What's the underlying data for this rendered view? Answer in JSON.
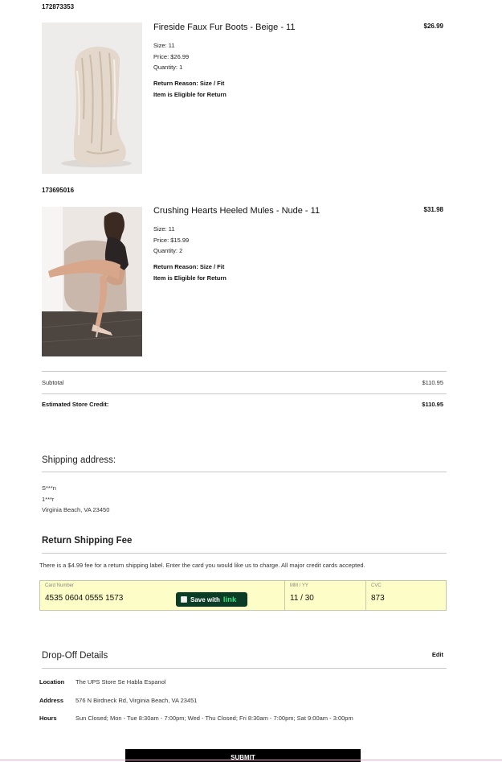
{
  "items": [
    {
      "order_id": "172873353",
      "title": "Fireside Faux Fur Boots - Beige - 11",
      "total": "$26.99",
      "size": "Size: 11",
      "price": "Price: $26.99",
      "quantity": "Quantity: 1",
      "return_reason": "Return Reason: Size / Fit",
      "eligibility": "Item is Eligible for Return"
    },
    {
      "order_id": "173695016",
      "title": "Crushing Hearts Heeled Mules - Nude - 11",
      "total": "$31.98",
      "size": "Size: 11",
      "price": "Price: $15.99",
      "quantity": "Quantity: 2",
      "return_reason": "Return Reason: Size / Fit",
      "eligibility": "Item is Eligible for Return"
    }
  ],
  "summary": {
    "subtotal_label": "Subtotal",
    "subtotal_value": "$110.95",
    "credit_label": "Estimated Store Credit:",
    "credit_value": "$110.95"
  },
  "shipping_address": {
    "title": "Shipping address:",
    "line1": "S***n",
    "line2": "1***r",
    "line3": "Virginia Beach, VA 23450"
  },
  "return_fee": {
    "title": "Return Shipping Fee",
    "note": "There is a $4.99 fee for a return shipping label. Enter the card you would like us to charge. All major credit cards accepted.",
    "card_number_label": "Card Number",
    "card_number_value": "4535 0604 0555 1573",
    "expiry_label": "MM / YY",
    "expiry_value": "11 / 30",
    "cvc_label": "CVC",
    "cvc_value": "873",
    "link_save_text": "Save with",
    "link_brand": "link"
  },
  "drop_off": {
    "title": "Drop-Off Details",
    "edit_label": "Edit",
    "location_label": "Location",
    "location_value": "The UPS Store Se Habla Espanol",
    "address_label": "Address",
    "address_value": "576 N Birdneck Rd, Virginia Beach, VA 23451",
    "hours_label": "Hours",
    "hours_value": "Sun Closed; Mon - Tue 8:30am - 7:00pm; Wed - Thu Closed; Fri 8:30am - 7:00pm; Sat 9:00am - 3:00pm"
  },
  "submit_label": "SUBMIT",
  "colors": {
    "card_background": "#fdfdc7",
    "link_pill": "#0b3d26",
    "link_brand": "#2fe27a",
    "submit_background": "#000000"
  }
}
